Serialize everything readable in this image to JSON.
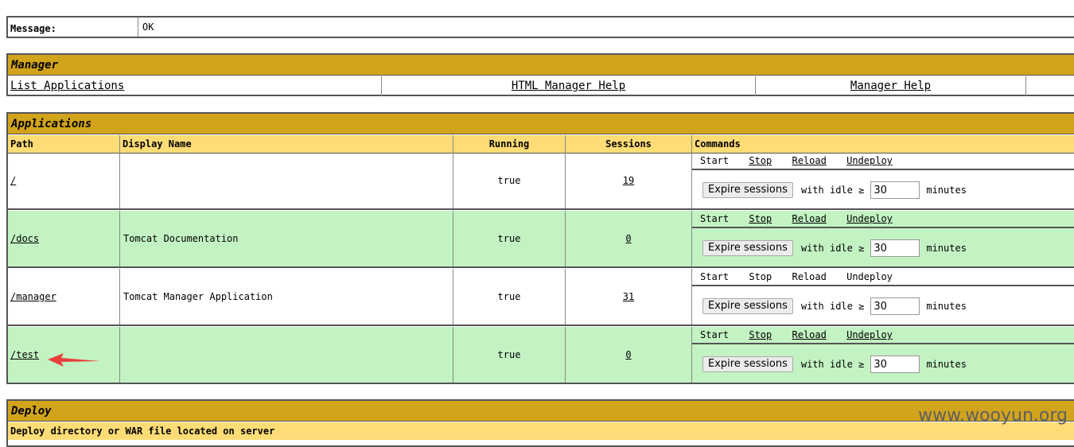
{
  "message": {
    "label": "Message:",
    "value": "OK"
  },
  "manager": {
    "title": "Manager",
    "links": [
      "List Applications",
      "HTML Manager Help",
      "Manager Help"
    ]
  },
  "applications": {
    "title": "Applications",
    "columns": [
      "Path",
      "Display Name",
      "Running",
      "Sessions",
      "Commands"
    ],
    "rows": [
      {
        "path": "/",
        "display_name": "",
        "running": "true",
        "sessions": "19",
        "commands": [
          "Start",
          "Stop",
          "Reload",
          "Undeploy"
        ],
        "idle": "30"
      },
      {
        "path": "/docs",
        "display_name": "Tomcat Documentation",
        "running": "true",
        "sessions": "0",
        "commands": [
          "Start",
          "Stop",
          "Reload",
          "Undeploy"
        ],
        "idle": "30"
      },
      {
        "path": "/manager",
        "display_name": "Tomcat Manager Application",
        "running": "true",
        "sessions": "31",
        "commands": [
          "Start",
          "Stop",
          "Reload",
          "Undeploy"
        ],
        "idle": "30"
      },
      {
        "path": "/test",
        "display_name": "",
        "running": "true",
        "sessions": "0",
        "commands": [
          "Start",
          "Stop",
          "Reload",
          "Undeploy"
        ],
        "idle": "30"
      }
    ],
    "expire_label": "Expire sessions",
    "with_idle_label": "with idle ≥",
    "minutes_label": "minutes"
  },
  "deploy": {
    "title": "Deploy",
    "subtitle": "Deploy directory or WAR file located on server"
  },
  "watermark": "www.wooyun.org",
  "colors": {
    "section_header": "#d2a41c",
    "column_header": "#ffdc75",
    "alt_row": "#c3f3c3",
    "annotation_arrow": "#e8403a"
  }
}
